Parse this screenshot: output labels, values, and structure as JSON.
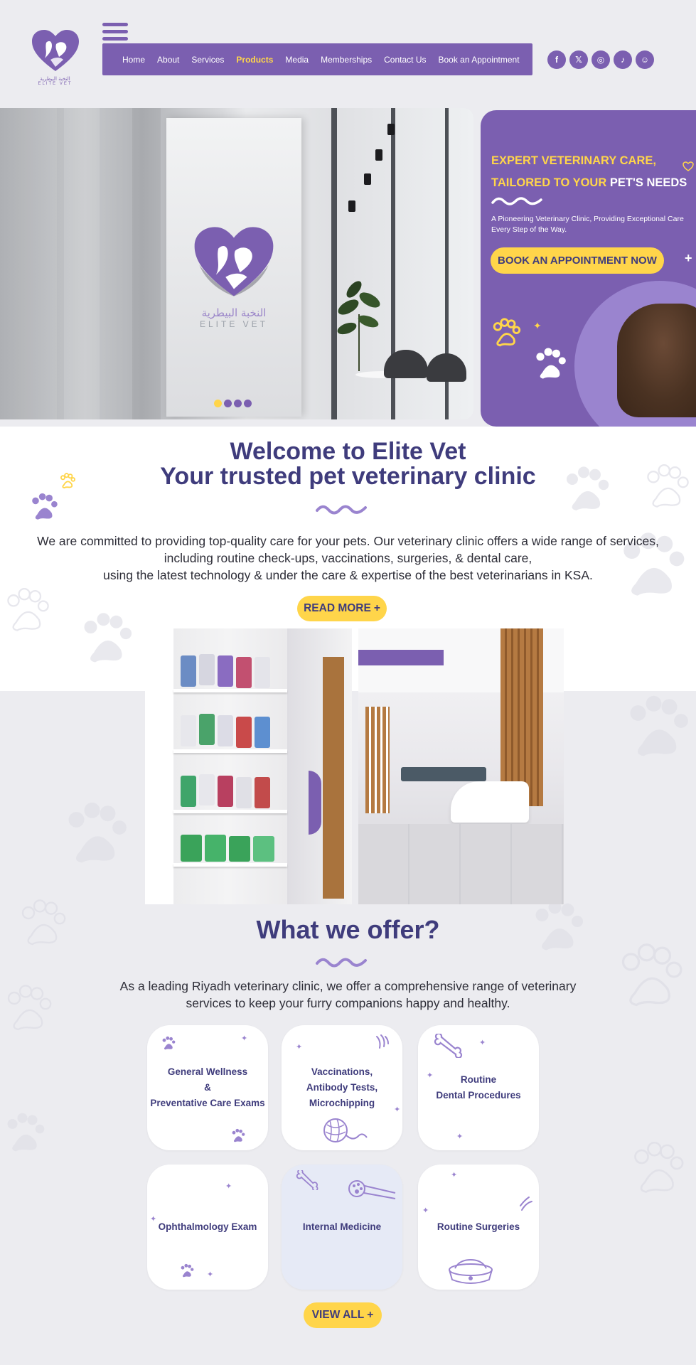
{
  "brand": {
    "name_ar": "النخبة البيطرية",
    "name_en": "ELITE VET",
    "colors": {
      "purple": "#7b5fb0",
      "yellow": "#ffd54a",
      "navy": "#3f3c7c"
    }
  },
  "nav": {
    "items": [
      {
        "label": "Home",
        "active": false
      },
      {
        "label": "About",
        "active": false
      },
      {
        "label": "Services",
        "active": false
      },
      {
        "label": "Products",
        "active": true
      },
      {
        "label": "Media",
        "active": false
      },
      {
        "label": "Memberships",
        "active": false
      },
      {
        "label": "Contact Us",
        "active": false
      },
      {
        "label": "Book an Appointment",
        "active": false
      }
    ]
  },
  "socials": [
    {
      "icon": "facebook-icon",
      "glyph": "f"
    },
    {
      "icon": "x-icon",
      "glyph": "𝕏"
    },
    {
      "icon": "instagram-icon",
      "glyph": "◎"
    },
    {
      "icon": "tiktok-icon",
      "glyph": "♪"
    },
    {
      "icon": "snapchat-icon",
      "glyph": "☺"
    }
  ],
  "hero": {
    "title_line1": "EXPERT VETERINARY CARE,",
    "title_line2_yellow": "TAILORED TO YOUR ",
    "title_line2_white": "PET'S NEEDS",
    "subtitle_line1": "A Pioneering Veterinary Clinic, Providing Exceptional Care",
    "subtitle_line2": "Every Step of the Way.",
    "cta": "BOOK AN APPOINTMENT NOW",
    "cta_icon": "+",
    "slides": 4,
    "active_slide": 1
  },
  "welcome": {
    "title_line1": "Welcome to Elite Vet",
    "title_line2": "Your trusted pet veterinary clinic",
    "text_line1": "We are committed to providing top-quality care for your pets. Our veterinary clinic offers a wide range of services,",
    "text_line2": "including routine check-ups, vaccinations, surgeries, & dental care,",
    "text_line3": "using the latest technology & under the care & expertise of the best veterinarians in KSA.",
    "read_more": "READ MORE",
    "plus": "+"
  },
  "offer": {
    "title": "What we offer?",
    "text_line1": "As a leading Riyadh veterinary clinic, we offer a comprehensive range of veterinary",
    "text_line2": "services to keep your furry companions happy and healthy.",
    "cards": [
      {
        "label": "General Wellness\n&\nPreventative Care Exams"
      },
      {
        "label": "Vaccinations,\nAntibody Tests,\nMicrochipping"
      },
      {
        "label": "Routine\nDental Procedures"
      },
      {
        "label": "Ophthalmology Exam"
      },
      {
        "label": "Internal Medicine"
      },
      {
        "label": "Routine Surgeries"
      }
    ],
    "view_all": "VIEW ALL",
    "plus": "+"
  }
}
